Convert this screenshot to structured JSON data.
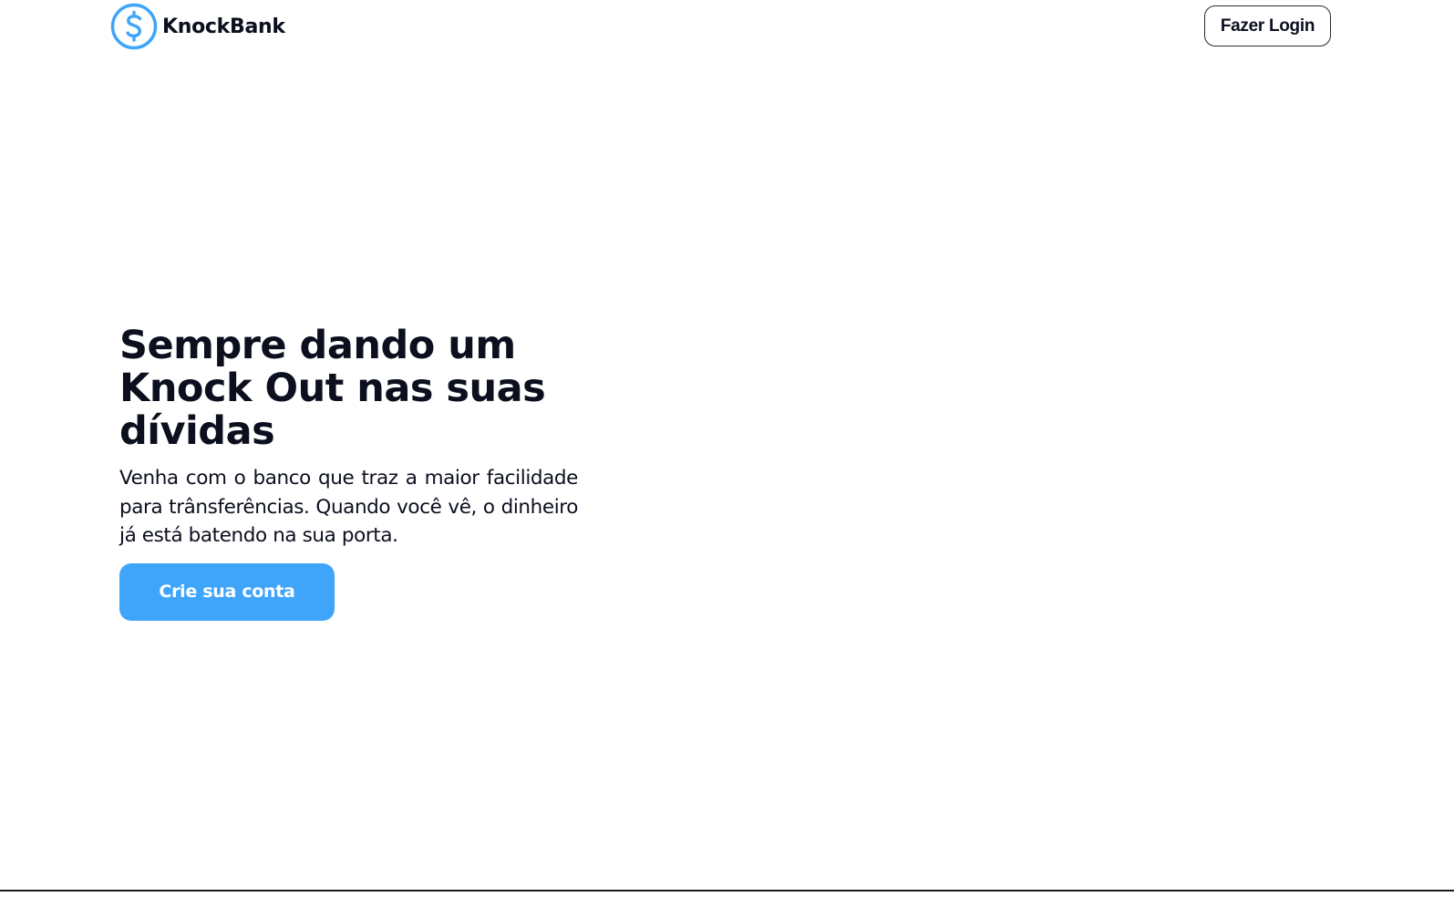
{
  "header": {
    "brand_name": "KnockBank",
    "logo_icon": "dollar-circle-icon",
    "login_label": "Fazer Login"
  },
  "hero": {
    "title": "Sempre dando um Knock Out nas suas dívidas",
    "subtitle": "Venha com o banco que traz a maior facilidade para trânsferências. Quando você vê, o dinheiro já está batendo na sua porta.",
    "cta_label": "Crie sua conta"
  },
  "colors": {
    "accent": "#3ea5fb",
    "text": "#0b0f1e",
    "background": "#ffffff"
  }
}
